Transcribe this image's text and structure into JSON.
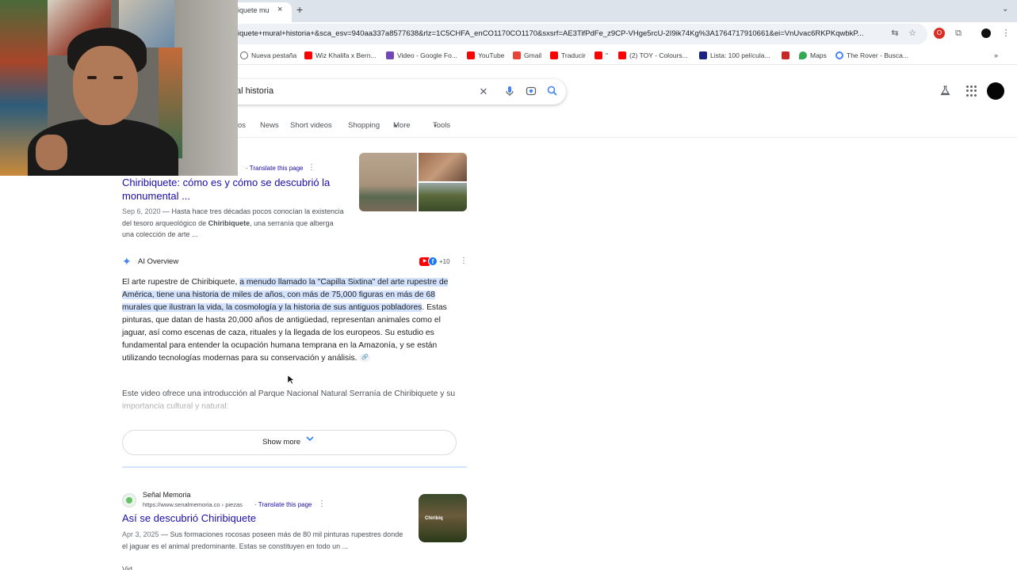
{
  "browser": {
    "tab_title": "iquete mu",
    "tab_close": "×",
    "new_tab": "+",
    "tab_menu": "⌄",
    "url": "iquete+mural+historia+&sca_esv=940aa337a8577638&rlz=1C5CHFA_enCO1170CO1170&sxsrf=AE3TifPdFe_z9CP-VHge5rcU-2I9ik74Kg%3A1764717910661&ei=VnUvac6RKPKqwbkP...",
    "bookmarks": [
      {
        "label": "Nueva pestaña",
        "icon": "globe-icon",
        "color": "#5f6368"
      },
      {
        "label": "Wiz Khalifa x Bern...",
        "icon": "youtube-icon",
        "color": "#ff0000"
      },
      {
        "label": "Video - Google Fo...",
        "icon": "google-forms-icon",
        "color": "#7248b9"
      },
      {
        "label": "YouTube",
        "icon": "youtube-icon",
        "color": "#ff0000"
      },
      {
        "label": "Gmail",
        "icon": "gmail-icon",
        "color": "#ea4335"
      },
      {
        "label": "Traducir",
        "icon": "youtube-icon",
        "color": "#ff0000"
      },
      {
        "label": "\"",
        "icon": "youtube-icon",
        "color": "#ff0000"
      },
      {
        "label": "(2) TOY - Colours...",
        "icon": "youtube-icon",
        "color": "#ff0000"
      },
      {
        "label": "Lista: 100 película...",
        "icon": "list-icon",
        "color": "#1a237e"
      },
      {
        "label": "",
        "icon": "up-icon",
        "color": "#c62828"
      },
      {
        "label": "Maps",
        "icon": "maps-icon",
        "color": "#34a853"
      },
      {
        "label": "The Rover - Busca...",
        "icon": "google-icon",
        "color": "#4285f4"
      }
    ],
    "more_bookmarks": "»"
  },
  "search": {
    "query": "al historia",
    "filters": [
      "os",
      "News",
      "Short videos",
      "Shopping",
      "More",
      "Tools"
    ]
  },
  "result1": {
    "translate": "· Translate this page",
    "title": "Chiribiquete: cómo es y cómo se descubrió la monumental ...",
    "date": "Sep 6, 2020",
    "snippet_pre": " — Hasta hace tres décadas pocos conocían la existencia del tesoro arqueológico de ",
    "snippet_bold": "Chiribiquete",
    "snippet_post": ", una serranía que alberga una colección de arte ..."
  },
  "ai_overview": {
    "label": "AI Overview",
    "source_count": "+10",
    "text_plain_1": "El arte rupestre de Chiribiquete, ",
    "text_highlight": "a menudo llamado la \"Capilla Sixtina\" del arte rupestre de América, tiene una historia de miles de años, con más de 75,000 figuras en más de 68 murales que ilustran la vida, la cosmología y la historia de sus antiguos pobladores",
    "text_plain_2": ". Estas pinturas, que datan de hasta 20,000 años de antigüedad, representan animales como el jaguar, así como escenas de caza, rituales y la llegada de los europeos. Su estudio es fundamental para entender la ocupación humana temprana en la Amazonía, y se están utilizando tecnologías modernas para su conservación y análisis.",
    "video_intro": "Este video ofrece una introducción al Parque Nacional Natural Serranía de Chiribiquete y su importancia cultural y natural:",
    "show_more": "Show more"
  },
  "result2": {
    "site_name": "Señal Memoria",
    "url": "https://www.senalmemoria.co › piezas",
    "translate": "· Translate this page",
    "title": "Así se descubrió Chiribiquete",
    "date": "Apr 3, 2025",
    "snippet": " — Sus formaciones rocosas poseen más de 80 mil pinturas rupestres donde el jaguar es el animal predominante. Estas se constituyen en todo un ...",
    "thumb_text": "Chiribiq"
  },
  "result3": {
    "peek": "Vid"
  },
  "colors": {
    "link": "#1a0dab",
    "highlight": "#d3e3fd",
    "accent": "#1a73e8"
  }
}
